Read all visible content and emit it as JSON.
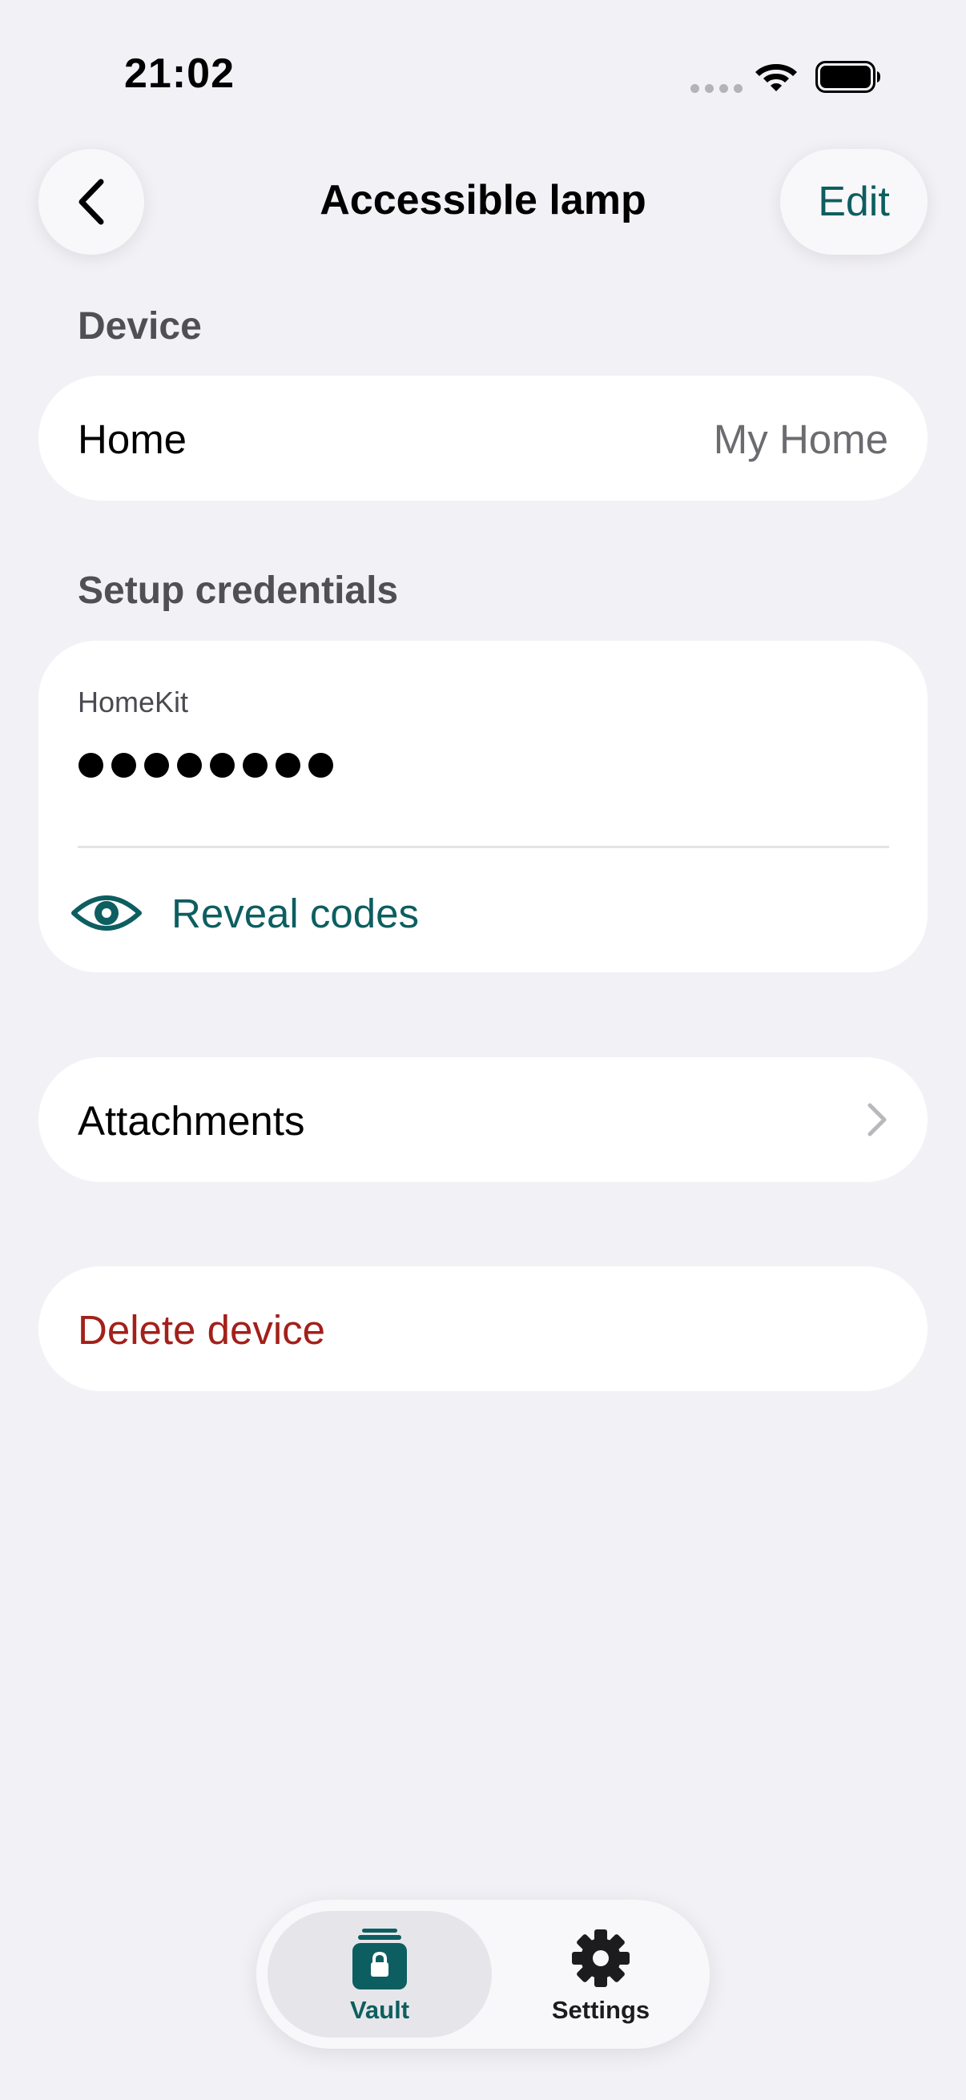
{
  "status_bar": {
    "time": "21:02"
  },
  "nav": {
    "title": "Accessible lamp",
    "edit_label": "Edit"
  },
  "sections": {
    "device_header": "Device",
    "credentials_header": "Setup credentials"
  },
  "device": {
    "home_label": "Home",
    "home_value": "My Home"
  },
  "credentials": {
    "label": "HomeKit",
    "masked_code": "••••••••",
    "reveal_label": "Reveal codes"
  },
  "attachments": {
    "label": "Attachments"
  },
  "delete": {
    "label": "Delete device"
  },
  "tabs": [
    {
      "label": "Vault",
      "icon": "vault-lock-icon",
      "selected": true
    },
    {
      "label": "Settings",
      "icon": "gear-icon",
      "selected": false
    }
  ],
  "colors": {
    "background": "#f2f1f6",
    "accent": "#0d5e60",
    "destructive": "#a3201a",
    "card": "#ffffff"
  }
}
